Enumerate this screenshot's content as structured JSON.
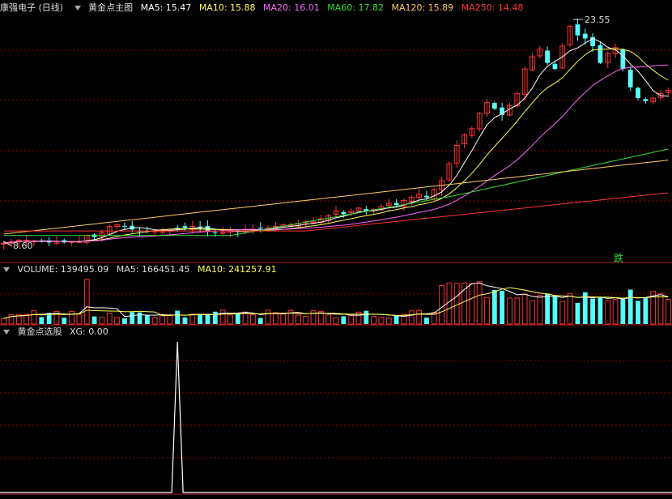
{
  "main_header": {
    "title": "康强电子 (日线)",
    "indicator_name": "黄金点主图",
    "ma_items": [
      {
        "label": "MA5: 15.47",
        "color": "#ffffff"
      },
      {
        "label": "MA10: 15.88",
        "color": "#ffff55"
      },
      {
        "label": "MA20: 16.01",
        "color": "#ff66ff"
      },
      {
        "label": "MA60: 17.82",
        "color": "#33dd33"
      },
      {
        "label": "MA120: 15.89",
        "color": "#ffcc66"
      },
      {
        "label": "MA250: 14.48",
        "color": "#ff3333"
      }
    ]
  },
  "price_annotations": {
    "high_label": "23.55",
    "low_label": "8.60",
    "signal_label": "跌"
  },
  "volume_header": {
    "items": [
      {
        "label": "VOLUME: 139495.09",
        "color": "#dddddd"
      },
      {
        "label": "MA5: 166451.45",
        "color": "#dddddd"
      },
      {
        "label": "MA10: 241257.91",
        "color": "#ffff55"
      }
    ]
  },
  "signal_header": {
    "items": [
      {
        "label": "黄金点选股",
        "color": "#dddddd"
      },
      {
        "label": "XG: 0.00",
        "color": "#dddddd"
      }
    ]
  },
  "colors": {
    "up": "#ff3333",
    "down": "#55ffff",
    "grid": "#8b0000",
    "panel_border": "#b02020"
  },
  "chart_data": {
    "type": "candlestick",
    "price_range": [
      8.6,
      23.55
    ],
    "closes": [
      8.8,
      8.9,
      9.0,
      9.0,
      8.95,
      8.9,
      8.9,
      8.9,
      8.85,
      8.9,
      8.9,
      9.3,
      9.2,
      9.5,
      9.9,
      10.0,
      9.9,
      9.7,
      9.6,
      9.6,
      9.6,
      9.7,
      9.7,
      9.8,
      9.8,
      9.9,
      9.8,
      9.6,
      9.5,
      9.5,
      9.6,
      9.6,
      9.7,
      9.7,
      9.8,
      9.8,
      9.9,
      10.0,
      10.0,
      10.1,
      10.2,
      10.2,
      10.4,
      10.6,
      10.9,
      10.7,
      10.9,
      11.1,
      10.9,
      11.0,
      11.2,
      11.4,
      11.3,
      11.6,
      11.8,
      12.0,
      11.8,
      12.3,
      12.9,
      14.0,
      15.2,
      15.9,
      16.3,
      17.3,
      18.0,
      17.6,
      17.2,
      17.8,
      18.6,
      20.2,
      21.0,
      21.5,
      20.6,
      20.2,
      21.7,
      23.0,
      22.4,
      22.2,
      21.7,
      20.6,
      21.2,
      21.6,
      20.2,
      19.0,
      18.3,
      18.1,
      18.3,
      18.6,
      18.8
    ],
    "xg_spike_index": 23,
    "xg_value": 0
  }
}
